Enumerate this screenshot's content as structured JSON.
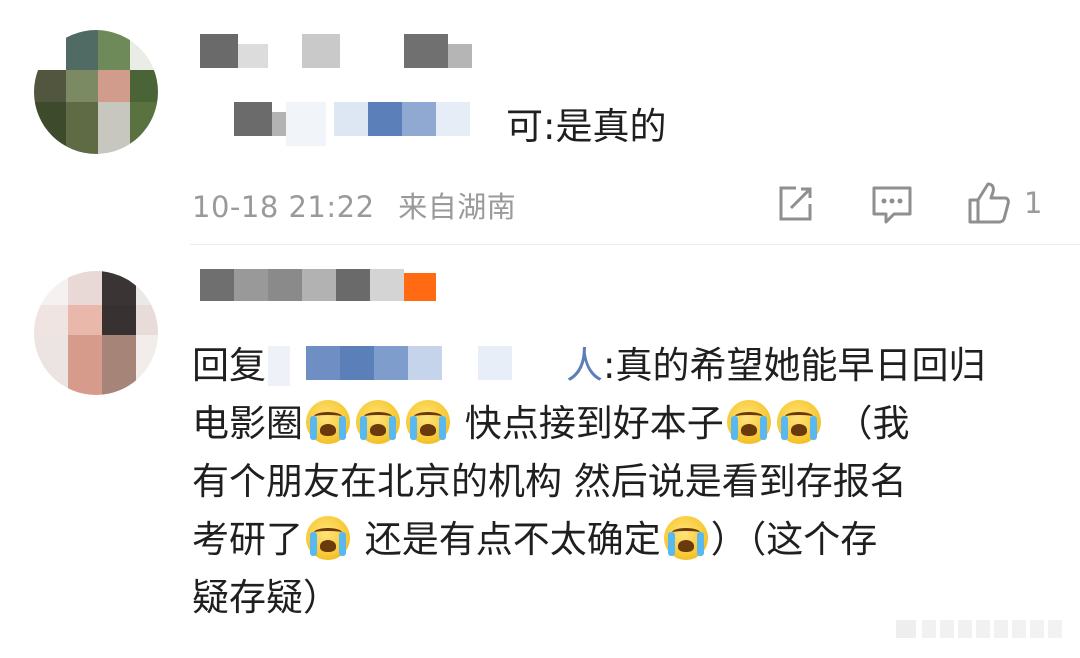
{
  "comments": [
    {
      "reply_suffix": "可:是真的",
      "time": "10-18 21:22",
      "location": "来自湖南",
      "like_count": "1",
      "icons": [
        "repost-icon",
        "comment-icon",
        "like-icon"
      ]
    },
    {
      "reply_prefix": "回复",
      "reply_handle_tail": "人",
      "lines": [
        ":真的希望她能早日回归",
        "电影圈",
        "快点接到好本子",
        "（我",
        "有个朋友在北京的机构 然后说是看到存报名",
        "考研了",
        "还是有点不太确定",
        "）（这个存",
        "疑存疑）"
      ]
    }
  ],
  "colors": {
    "meta_gray": "#9a9a9a",
    "text": "#1f1f1f",
    "divider": "#ececec",
    "handle_blue": "#5b7fb8",
    "orange_badge": "#ff6a13"
  }
}
